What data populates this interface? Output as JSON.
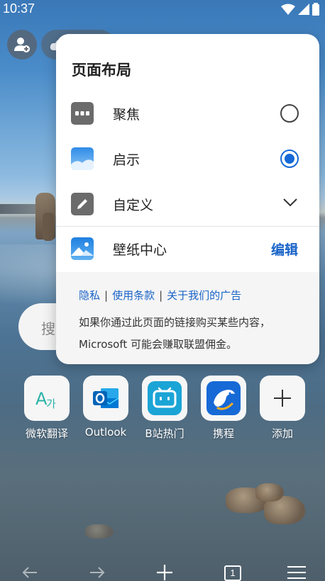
{
  "status_bar": {
    "time": "10:37"
  },
  "search": {
    "placeholder_partial": "搜索"
  },
  "popup": {
    "title": "页面布局",
    "options": [
      {
        "label": "聚焦",
        "icon": "focus-layout-icon",
        "selected": false
      },
      {
        "label": "启示",
        "icon": "inspiration-layout-icon",
        "selected": true
      },
      {
        "label": "自定义",
        "icon": "custom-layout-icon",
        "expandable": true
      }
    ],
    "wallpaper": {
      "label": "壁纸中心",
      "icon": "wallpaper-icon",
      "edit_label": "编辑"
    },
    "footer": {
      "links": [
        "隐私",
        "使用条款",
        "关于我们的广告"
      ],
      "separator": "|",
      "disclaimer_line1": "如果你通过此页面的链接购买某些内容，",
      "disclaimer_line2": "Microsoft 可能会赚取联盟佣金。"
    }
  },
  "quick_links": [
    {
      "label": "微软翻译",
      "icon": "translator-icon"
    },
    {
      "label": "Outlook",
      "icon": "outlook-icon"
    },
    {
      "label": "B站热门",
      "icon": "bilibili-icon"
    },
    {
      "label": "携程",
      "icon": "ctrip-icon"
    },
    {
      "label": "添加",
      "icon": "plus-icon"
    }
  ],
  "bottom_nav": {
    "tab_count": "1"
  },
  "colors": {
    "accent": "#1669d6",
    "link": "#1a64c8"
  }
}
